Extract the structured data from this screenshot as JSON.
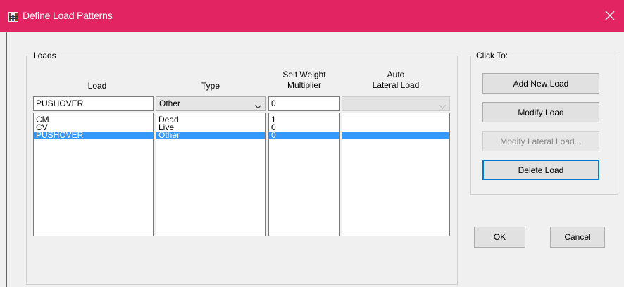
{
  "window": {
    "title": "Define Load Patterns",
    "close_glyph": "X",
    "accent_color": "#e32463"
  },
  "loads": {
    "legend": "Loads",
    "headers": {
      "load": "Load",
      "type": "Type",
      "self_weight_line1": "Self Weight",
      "self_weight_line2": "Multiplier",
      "auto_line1": "Auto",
      "auto_line2": "Lateral Load"
    },
    "edit_row": {
      "load": "PUSHOVER",
      "type": "Other",
      "multiplier": "0",
      "auto_lateral": ""
    },
    "rows": [
      {
        "load": "CM",
        "type": "Dead",
        "multiplier": "1",
        "auto_lateral": ""
      },
      {
        "load": "CV",
        "type": "Live",
        "multiplier": "0",
        "auto_lateral": ""
      },
      {
        "load": "PUSHOVER",
        "type": "Other",
        "multiplier": "0",
        "auto_lateral": "",
        "selected": true
      }
    ]
  },
  "click_to": {
    "legend": "Click To:",
    "add_new_load": "Add New Load",
    "modify_load": "Modify Load",
    "modify_lateral_load": "Modify Lateral Load...",
    "delete_load": "Delete Load"
  },
  "footer": {
    "ok": "OK",
    "cancel": "Cancel"
  },
  "icons": {
    "app": "building-icon",
    "close": "close-icon",
    "dropdown": "chevron-down-icon"
  },
  "colors": {
    "selection": "#3399ff",
    "focus_border": "#0078d7"
  }
}
